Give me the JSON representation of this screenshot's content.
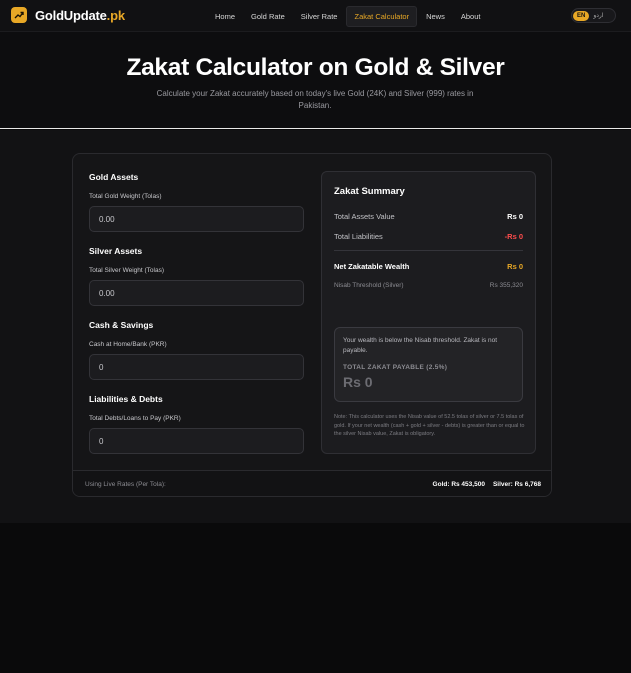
{
  "header": {
    "brand_main": "GoldUpdate",
    "brand_suffix": ".pk",
    "logo_icon": "trend-up-icon",
    "nav": [
      {
        "label": "Home"
      },
      {
        "label": "Gold Rate"
      },
      {
        "label": "Silver Rate"
      },
      {
        "label": "Zakat Calculator",
        "active": true
      },
      {
        "label": "News"
      },
      {
        "label": "About"
      }
    ],
    "lang": {
      "en": "EN",
      "ur": "اردو"
    }
  },
  "hero": {
    "title": "Zakat Calculator on Gold & Silver",
    "subtitle": "Calculate your Zakat accurately based on today's live Gold (24K) and Silver (999) rates in Pakistan."
  },
  "form": {
    "gold": {
      "title": "Gold Assets",
      "label": "Total Gold Weight (Tolas)",
      "value": "0.00"
    },
    "silver": {
      "title": "Silver Assets",
      "label": "Total Silver Weight (Tolas)",
      "value": "0.00"
    },
    "cash": {
      "title": "Cash & Savings",
      "label": "Cash at Home/Bank (PKR)",
      "value": "0"
    },
    "debts": {
      "title": "Liabilities & Debts",
      "label": "Total Debts/Loans to Pay (PKR)",
      "value": "0"
    }
  },
  "summary": {
    "title": "Zakat Summary",
    "assets_label": "Total Assets Value",
    "assets_value": "Rs 0",
    "liabilities_label": "Total Liabilities",
    "liabilities_value": "-Rs 0",
    "net_label": "Net Zakatable Wealth",
    "net_value": "Rs 0",
    "nisab_label": "Nisab Threshold (Silver)",
    "nisab_value": "Rs 355,320",
    "status_message": "Your wealth is below the Nisab threshold. Zakat is not payable.",
    "payable_label": "TOTAL ZAKAT PAYABLE (2.5%)",
    "payable_value": "Rs 0",
    "note": "Note: This calculator uses the Nisab value of 52.5 tolas of silver or 7.5 tolas of gold. If your net wealth (cash + gold + silver - debts) is greater than or equal to the silver Nisab value, Zakat is obligatory."
  },
  "footer": {
    "label": "Using Live Rates (Per Tola):",
    "gold": "Gold: Rs 453,500",
    "silver": "Silver: Rs 6,768"
  },
  "colors": {
    "accent": "#e8a826",
    "negative": "#ff4d4d",
    "background": "#0a0a0b"
  }
}
